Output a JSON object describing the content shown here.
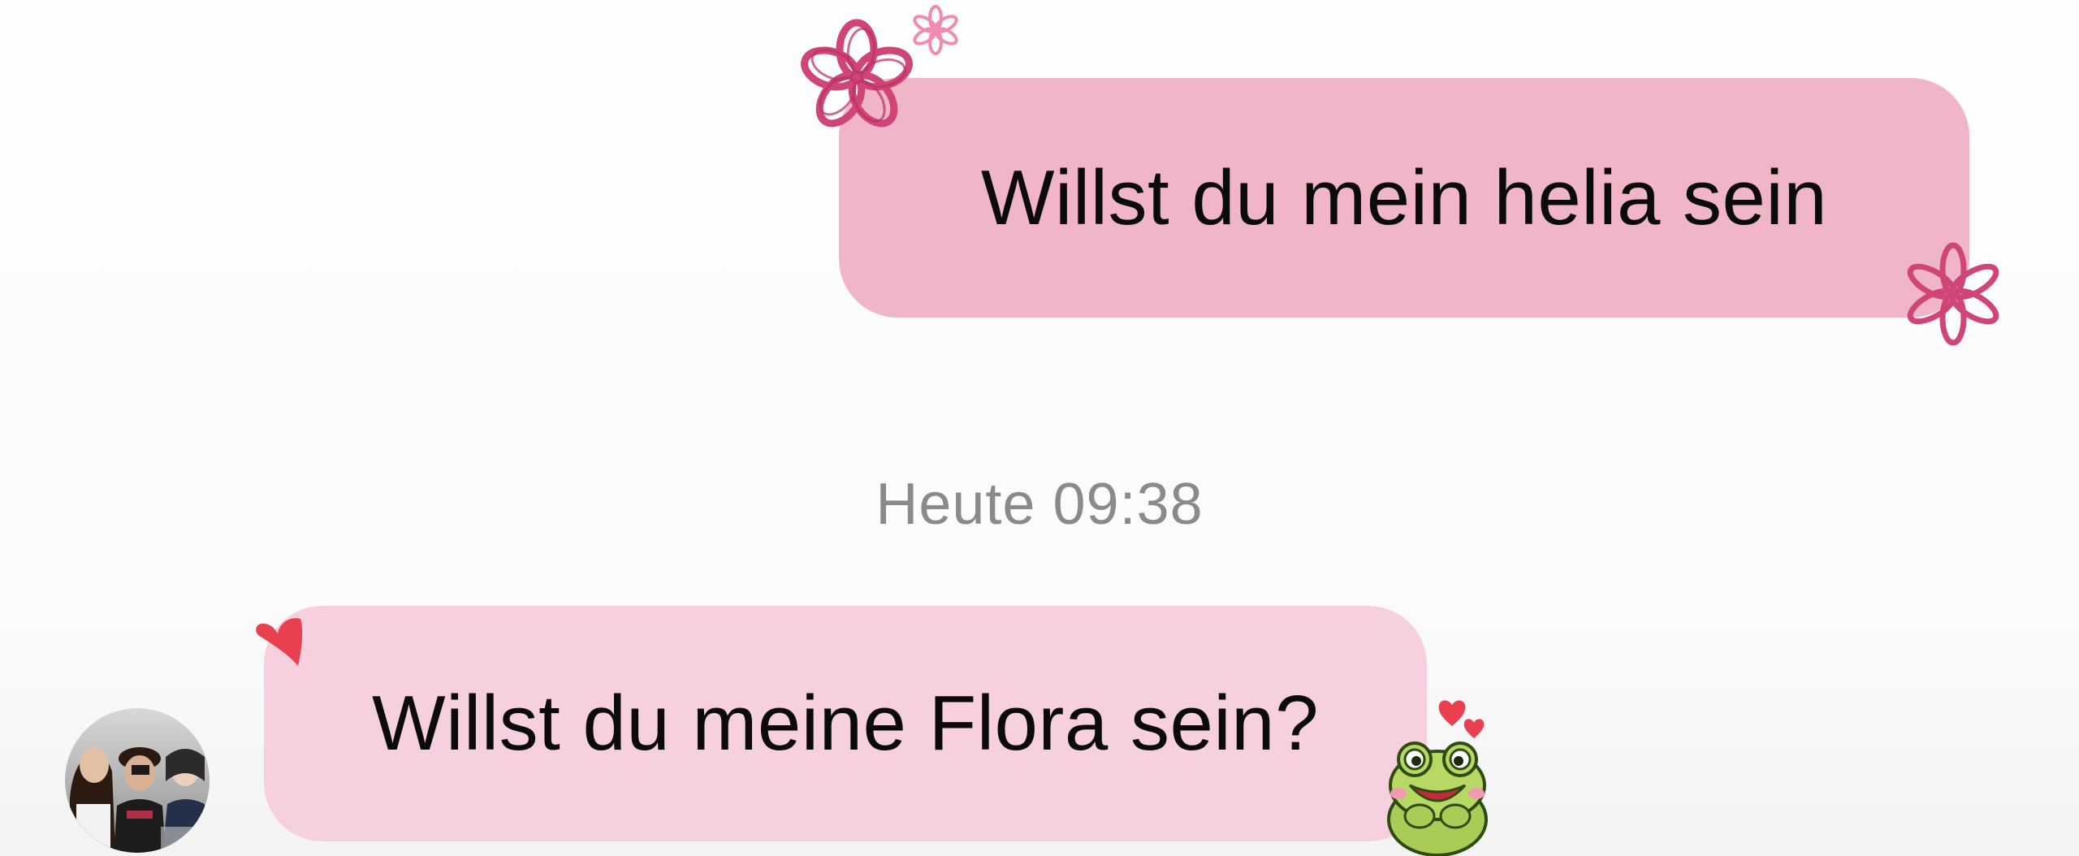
{
  "messages": {
    "outgoing": {
      "text": "Willst du mein helia sein"
    },
    "incoming": {
      "text": "Willst du meine Flora sein?"
    }
  },
  "timestamp": {
    "label": "Heute 09:38"
  },
  "icons": {
    "flower_large": "flower-icon",
    "flower_small": "flower-icon",
    "heart": "heart-icon",
    "frog_sticker": "frog-sticker-icon",
    "avatar": "avatar"
  },
  "colors": {
    "outgoing_bubble": "#f0b5c6",
    "incoming_bubble": "#f6d0df",
    "flower": "#cf4577",
    "heart": "#e8404f",
    "timestamp_text": "#8a8a8a",
    "frog": "#a9cc57"
  }
}
